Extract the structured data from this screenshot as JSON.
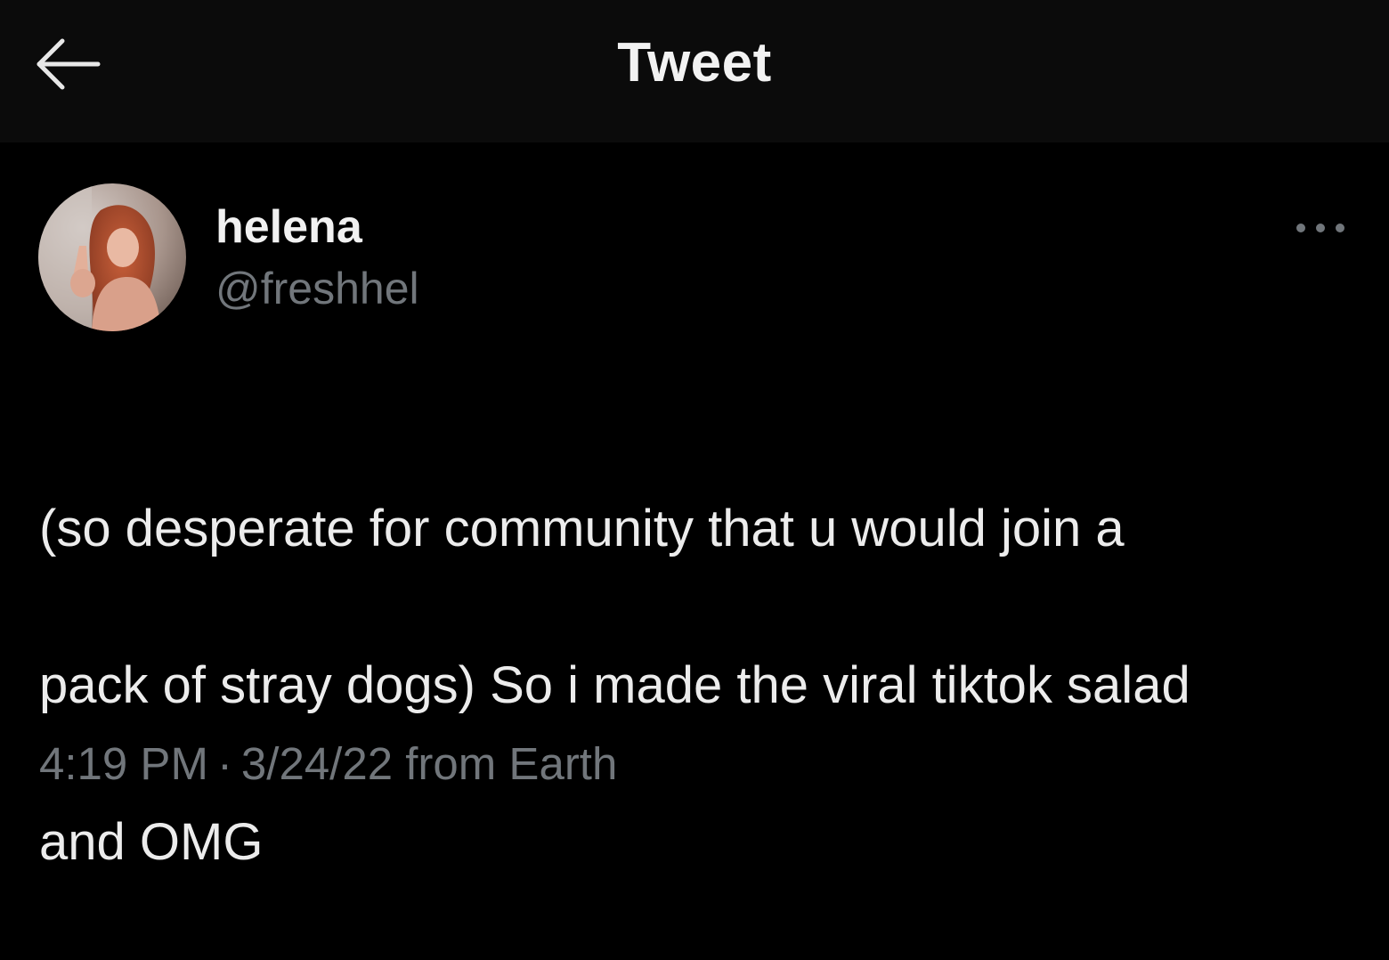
{
  "header": {
    "title": "Tweet",
    "back_icon": "arrow-left-icon"
  },
  "author": {
    "display_name": "helena",
    "handle": "@freshhel",
    "avatar": "profile-photo"
  },
  "more_icon": "more-horizontal-icon",
  "tweet": {
    "lines": [
      "(so desperate for community that u would join a",
      "pack of stray dogs) So i made the viral tiktok salad",
      "and OMG"
    ]
  },
  "meta": {
    "time": "4:19 PM",
    "separator": "·",
    "date": "3/24/22",
    "source": "from Earth"
  },
  "colors": {
    "background": "#000000",
    "header_background": "#0b0b0b",
    "primary_text": "#e7e9ea",
    "secondary_text": "#71767b"
  }
}
